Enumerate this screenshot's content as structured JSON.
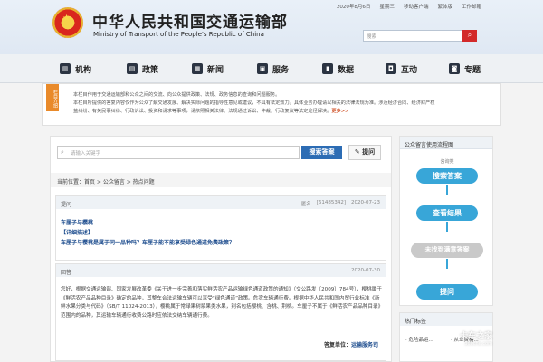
{
  "header": {
    "date": "2020年8月6日",
    "weekday": "星期三",
    "links": [
      "移动客户端",
      "繁体版",
      "工作邮箱"
    ],
    "title_cn": "中华人民共和国交通运输部",
    "title_en": "Ministry of Transport of the People's Republic of China",
    "search_placeholder": "搜索"
  },
  "nav": {
    "items": [
      {
        "label": "机构",
        "icon": "building-icon"
      },
      {
        "label": "政策",
        "icon": "policy-icon"
      },
      {
        "label": "新闻",
        "icon": "news-icon"
      },
      {
        "label": "服务",
        "icon": "service-icon"
      },
      {
        "label": "数据",
        "icon": "data-icon"
      },
      {
        "label": "互动",
        "icon": "chat-icon"
      },
      {
        "label": "专题",
        "icon": "topic-icon"
      }
    ]
  },
  "intro": {
    "badge": "栏目介绍",
    "line1": "本栏目作用于交通运输部和公众之间的交流、向公众提供政策、法规、政务信息的查询和问题服务。",
    "line2": "本栏目所提供的答复内容仅作为公众了解交通发展、解决实际问题的指导性意见或建议，不具有法定效力。具体业务办理请以相关的法律法规为准。涉及经济合同、经济财产权",
    "line3": "益纠纷、有关民事纠纷、行政诉讼、投资和请求等事项，请依照相关法律、法规通过诉讼、仲裁、行政复议等法定途径解决。",
    "more": "更多>>"
  },
  "main": {
    "search_placeholder": "请输入关键字",
    "search_button": "搜索答案",
    "ask_button": "提问",
    "breadcrumb": "当前位置：首页 > 公众留言 > 热点问题",
    "question": {
      "header": "提问",
      "author": "匿名",
      "id": "[61485342]",
      "date": "2020-07-23",
      "title": "车厘子与樱桃",
      "detail_label": "【详细描述】",
      "body": "车厘子与樱桃是属于同一品种吗？车厘子能不能享受绿色通道免费政策？"
    },
    "answer": {
      "header": "回答",
      "date": "2020-07-30",
      "body": "您好，根据交通运输部、国家发展改革委《关于进一步完善和落实鲜活农产品运输绿色通道政策的通知》（交公路发〔2009〕784号），樱桃属于《鲜活农产品品种目录》确定的品种，其整车合法运输车辆可以享受“绿色通道”政策。危农车辆通行费。根据中华人民共和国内贸行业标准《新鲜水果分类与代码》（SB/T 11024-2013），樱桃属于常绿果树浆果类水果，别名包括樱桃、含桃、荆桃。车厘子不属于《鲜活农产品品种目录》范围内的品种，其运输车辆通行收费公路时应依法交纳车辆通行费。",
      "sign_label": "答复单位：",
      "sign_unit": "运输服务司"
    }
  },
  "flow": {
    "title": "公众留言使用流程图",
    "step_label": "咨询类",
    "steps": [
      "搜索答案",
      "查看结果",
      "未找到满意答案",
      "提问"
    ]
  },
  "hot": {
    "title": "热门标签",
    "items": [
      "· 危险品运...",
      "· 从业资格..."
    ]
  },
  "watermark": {
    "text": "卡车之家",
    "url": "360che.com"
  }
}
